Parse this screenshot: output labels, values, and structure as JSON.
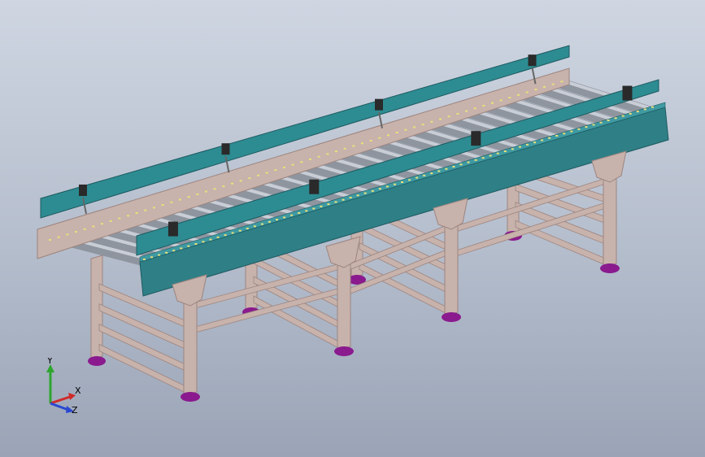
{
  "viewport": {
    "background_top": "#cfd6e2",
    "background_bottom": "#9aa4b6"
  },
  "model": {
    "name": "",
    "roller_count": 28,
    "leg_count": 5,
    "colors": {
      "side_rail": "#2f7f86",
      "side_rail_light": "#3f9aa2",
      "guide_rail": "#2d8c92",
      "roller": "#8e959f",
      "roller_light": "#c9ced6",
      "frame": "#c8b2ac",
      "frame_dark": "#9c857f",
      "chain_dots": "#e9e07a",
      "foot": "#8a1a8e",
      "clamp": "#2a2a2a"
    }
  },
  "triad": {
    "labels": {
      "y": "Y",
      "x": "X",
      "z": "Z"
    },
    "colors": {
      "y": "#2ea52e",
      "x": "#d02a2a",
      "z": "#2a48d0"
    }
  }
}
